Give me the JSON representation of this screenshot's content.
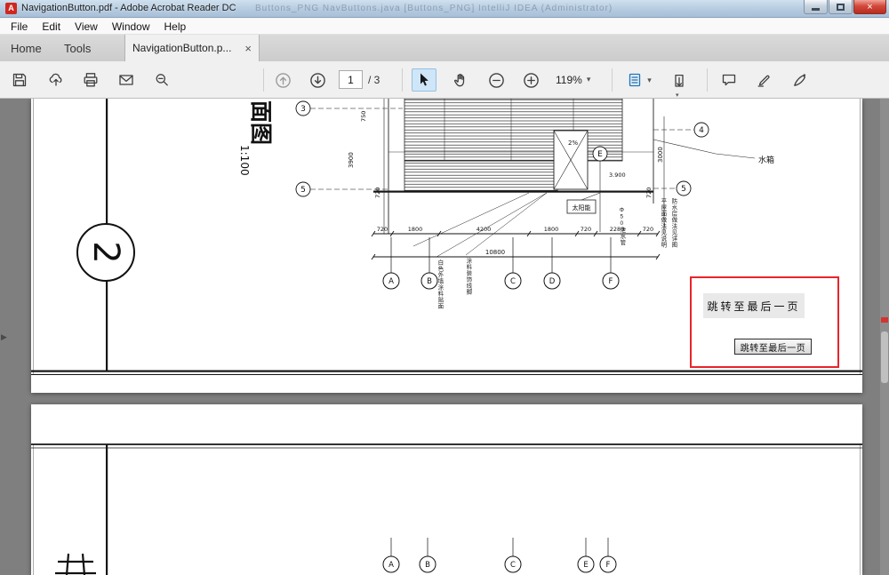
{
  "titlebar": {
    "title": "NavigationButton.pdf - Adobe Acrobat Reader DC",
    "ghost_title": "Buttons_PNG    NavButtons.java [Buttons_PNG]    IntelliJ IDEA (Administrator)",
    "close_glyph": "×",
    "app_icon_letter": "A"
  },
  "menubar": {
    "items": [
      "File",
      "Edit",
      "View",
      "Window",
      "Help"
    ]
  },
  "tabbar": {
    "home_label": "Home",
    "tools_label": "Tools",
    "document_tab": "NavigationButton.p...",
    "close_glyph": "×"
  },
  "toolbar": {
    "page_current": "1",
    "page_total": "/ 3",
    "zoom_value": "119%",
    "caret_glyph": "▾",
    "icons": [
      "save",
      "cloud-upload",
      "print",
      "email",
      "marquee-zoom",
      "previous-page",
      "next-page",
      "select-tool",
      "hand-tool",
      "zoom-out",
      "zoom-in",
      "page-display",
      "scrolling-mode",
      "comment",
      "highlight",
      "fill-sign"
    ]
  },
  "viewport": {
    "nav_pane_glyph": "▶"
  },
  "drawing": {
    "sheet_number": "2",
    "title_text": "面图",
    "scale_text": "1:100",
    "grid_left_top": "3",
    "grid_left_bottom": "5",
    "grid_right_top": "4",
    "grid_right_bottom": "5",
    "grid_e": "E",
    "grid_bottom": [
      "A",
      "B",
      "C",
      "D",
      "F"
    ],
    "grid_bottom_p2": [
      "A",
      "B",
      "C",
      "E",
      "F"
    ],
    "dims_bottom": [
      "720",
      "1800",
      "4200",
      "1800",
      "720",
      "2280",
      "720"
    ],
    "dim_total": "10800",
    "dim_left_1": "750",
    "dim_left_2": "3900",
    "dim_left_3": "720",
    "dim_right_1": "3000",
    "dim_right_2": "720",
    "ann_slope": "2%",
    "ann_level": "3.900",
    "ann_water_tank": "水箱",
    "ann_solar": "太阳能",
    "ann_drain": "Φ50泄水管",
    "note_right_1": "平屋面做法见说明",
    "note_right_2": "防水层做法见详图",
    "note_bottom_1": "白色外墙涂料贴面",
    "note_bottom_2": "涂料装饰线脚"
  },
  "annotation": {
    "box_color": "#e8252a",
    "label_text": "跳转至最后一页",
    "button_text": "跳转至最后一页"
  }
}
